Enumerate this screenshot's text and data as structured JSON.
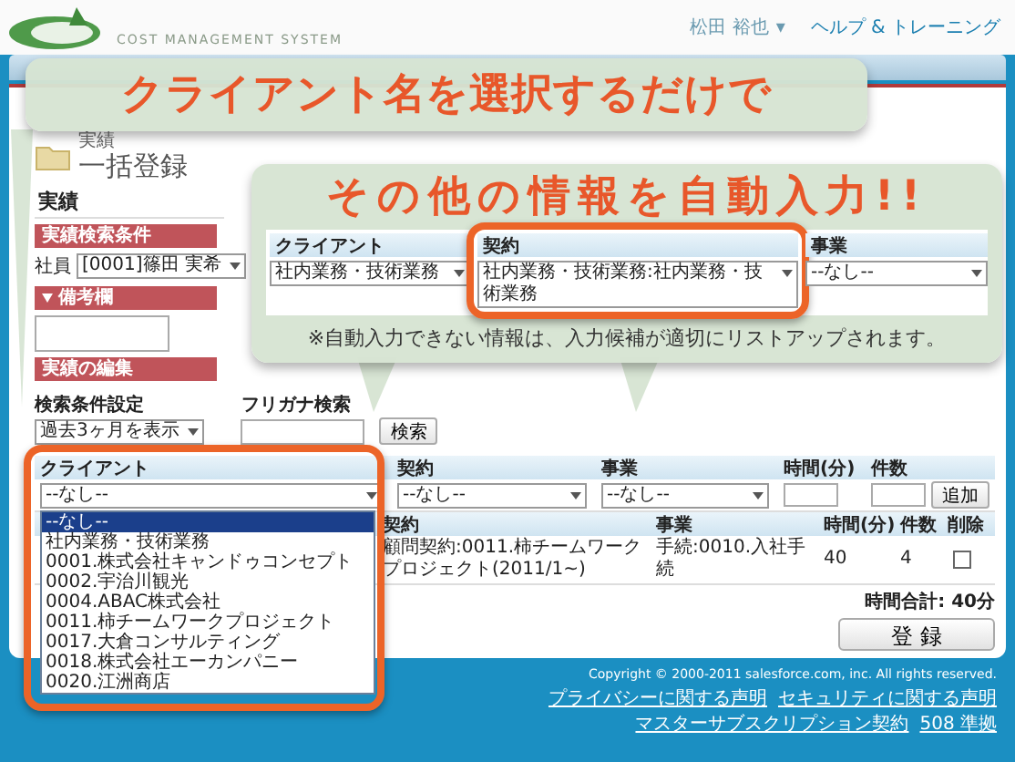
{
  "header": {
    "logo_text": "COST MANAGEMENT SYSTEM",
    "user_menu": "松田 裕也",
    "user_menu_caret": "▾",
    "help_link": "ヘルプ & トレーニング"
  },
  "page": {
    "breadcrumb": "実績",
    "title": "一括登録",
    "section_title": "実績"
  },
  "search_conditions": {
    "header": "実績検索条件",
    "employee_label": "社員",
    "employee_value": "[0001]篠田 実希"
  },
  "remarks": {
    "header": "備考欄",
    "expanded": true
  },
  "edit": {
    "header": "実績の編集",
    "filter_label": "検索条件設定",
    "filter_value": "過去3ヶ月を表示",
    "kana_label": "フリガナ検索",
    "search_button": "検索"
  },
  "entry_table": {
    "columns": [
      "クライアント",
      "契約",
      "事業",
      "時間(分)",
      "件数"
    ],
    "client": "--なし--",
    "contract": "--なし--",
    "project": "--なし--",
    "add_button": "追加"
  },
  "client_dropdown": {
    "options": [
      {
        "label": "--なし--",
        "selected": true
      },
      {
        "label": "社内業務・技術業務",
        "selected": false
      },
      {
        "label": "0001.株式会社キャンドゥコンセプト",
        "selected": false
      },
      {
        "label": "0002.宇治川観光",
        "selected": false
      },
      {
        "label": "0004.ABAC株式会社",
        "selected": false
      },
      {
        "label": "0011.柿チームワークプロジェクト",
        "selected": false
      },
      {
        "label": "0017.大倉コンサルティング",
        "selected": false
      },
      {
        "label": "0018.株式会社エーカンパニー",
        "selected": false
      },
      {
        "label": "0020.江洲商店",
        "selected": false
      }
    ]
  },
  "results_table": {
    "columns": [
      "契約",
      "事業",
      "時間(分)",
      "件数",
      "削除"
    ],
    "rows": [
      {
        "contract": "顧問契約:0011.柿チームワークプロジェクト(2011/1~)",
        "project": "手続:0010.入社手続",
        "minutes": "40",
        "count": "4",
        "delete": false
      }
    ]
  },
  "total": "時間合計: 40分",
  "register_button": "登 録",
  "footer": {
    "copyright": "Copyright © 2000-2011 salesforce.com, inc. All rights reserved.",
    "links": [
      "プライバシーに関する声明",
      "セキュリティに関する声明",
      "マスターサブスクリプション契約",
      "508 準拠"
    ]
  },
  "callout_top": {
    "text": "クライアント名を選択するだけで"
  },
  "callout_bottom": {
    "text": "その他の情報を自動入力!!",
    "preview": {
      "columns": [
        "クライアント",
        "契約",
        "事業"
      ],
      "values": [
        "社内業務・技術業務",
        "社内業務・技術業務:社内業務・技術業務",
        "--なし--"
      ]
    },
    "note": "※自動入力できない情報は、入力候補が適切にリストアップされます。"
  }
}
